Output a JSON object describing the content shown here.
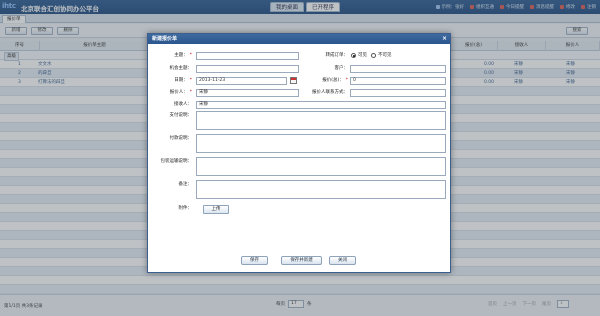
{
  "header": {
    "logo": "ihtc",
    "app_title": "北京联合汇创协同办公平台",
    "tabs": [
      {
        "label": "我的桌面"
      },
      {
        "label": "已开程序"
      }
    ],
    "right_items": [
      {
        "label": "示例：张好",
        "icon": "user-icon"
      },
      {
        "label": "组织互通",
        "icon": "org-icon"
      },
      {
        "label": "今日提醒",
        "icon": "reminder-icon"
      },
      {
        "label": "消息提醒",
        "icon": "message-icon"
      },
      {
        "label": "修改",
        "icon": "edit-icon"
      },
      {
        "label": "注销",
        "icon": "logout-icon"
      }
    ]
  },
  "page_tab": {
    "label": "报价单"
  },
  "toolbar": {
    "new_label": "新增",
    "edit_label": "修改",
    "delete_label": "删除",
    "search_label": "搜索"
  },
  "grid": {
    "columns": [
      "序号",
      "报价单主题",
      "报价(总)",
      "接收人",
      "报价人"
    ],
    "filter_label": "高级",
    "rows": [
      {
        "index": "1",
        "subject": "文文水",
        "price": "0.00",
        "receiver": "宋静",
        "quoter": "宋静"
      },
      {
        "index": "2",
        "subject": "的辟旦",
        "price": "0.00",
        "receiver": "宋静",
        "quoter": "宋静"
      },
      {
        "index": "3",
        "subject": "打算法的辟旦",
        "price": "0.00",
        "receiver": "宋静",
        "quoter": "宋静"
      }
    ]
  },
  "status": {
    "left": "第1/1页 共3条记录",
    "page_prefix": "每页",
    "page_size": "17",
    "page_suffix": "条",
    "first": "首页",
    "prev": "上一页",
    "next": "下一页",
    "last": "尾页",
    "goto": "1"
  },
  "modal": {
    "title": "新建报价单",
    "close_icon": "close-icon",
    "fields": {
      "subject_label": "主题：",
      "convert_label": "转成订单：",
      "convert_yes": "可见",
      "convert_no": "不可见",
      "opportunity_label": "机会主题：",
      "customer_label": "客户：",
      "date_label": "日期：",
      "date_value": "2013-11-23",
      "total_label": "报价(总)：",
      "total_value": "0",
      "quoter_label": "报价人：",
      "quoter_value": "宋静",
      "quoter_contact_label": "报价人联系方式：",
      "receiver_label": "接收人：",
      "receiver_value": "宋静",
      "payment_desc_label": "支付说明：",
      "payment_terms_label": "付款说明：",
      "packing_label": "包装运输说明：",
      "remarks_label": "备注：",
      "attachment_label": "附件："
    },
    "upload_label": "上传",
    "save_label": "保存",
    "save_new_label": "保存并新建",
    "close_label": "关闭"
  }
}
